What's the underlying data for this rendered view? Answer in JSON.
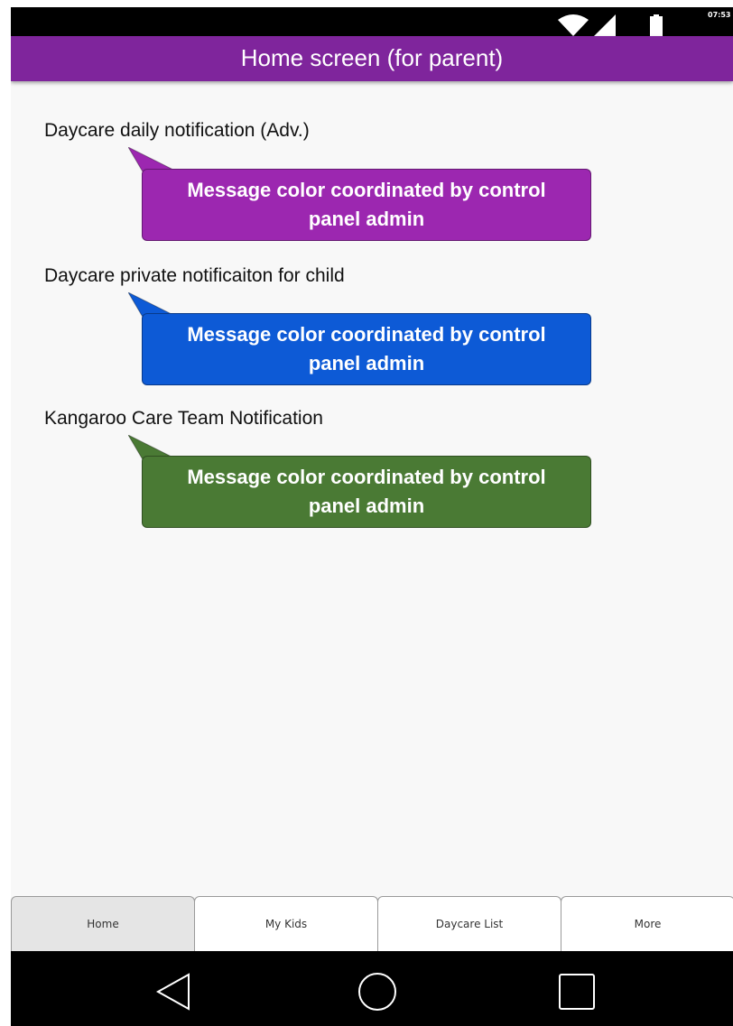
{
  "status": {
    "time": "07:53",
    "icons": [
      "wifi-icon",
      "signal-icon",
      "battery-icon"
    ]
  },
  "header": {
    "title": "Home screen (for parent)",
    "color": "#7f259c"
  },
  "notifications": [
    {
      "label": "Daycare daily notification (Adv.)",
      "message": "Message color coordinated by control panel admin",
      "color": "#9c27b0"
    },
    {
      "label": "Daycare private notificaiton for child",
      "message": "Message color coordinated by control panel admin",
      "color": "#0d5ad6"
    },
    {
      "label": "Kangaroo Care Team Notification",
      "message": "Message color coordinated by control panel admin",
      "color": "#4a7a34"
    }
  ],
  "tabs": [
    {
      "label": "Home",
      "active": true
    },
    {
      "label": "My Kids",
      "active": false
    },
    {
      "label": "Daycare List",
      "active": false
    },
    {
      "label": "More",
      "active": false
    }
  ],
  "nav": [
    "back-icon",
    "home-icon",
    "recents-icon"
  ]
}
